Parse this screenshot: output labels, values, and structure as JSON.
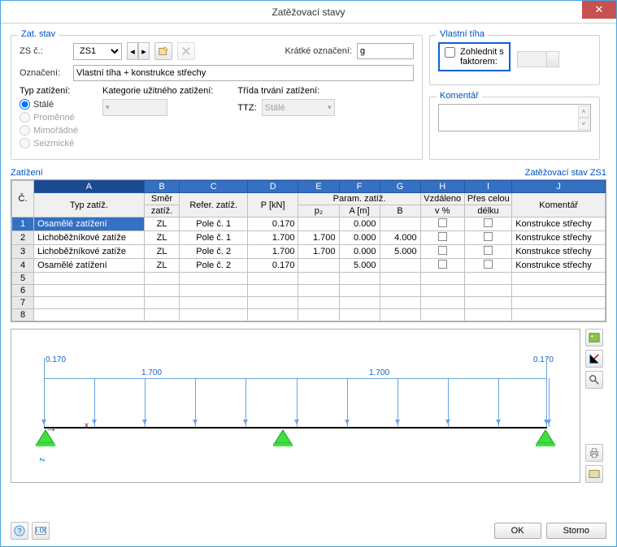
{
  "title": "Zatěžovací stavy",
  "zat_stav": {
    "legend": "Zat. stav",
    "zs_label": "ZS č.:",
    "zs_value": "ZS1",
    "kratke_label": "Krátké označení:",
    "kratke_value": "g",
    "oznaceni_label": "Označení:",
    "oznaceni_value": "Vlastní tíha + konstrukce střechy",
    "typ_label": "Typ zatížení:",
    "radios": [
      "Stálé",
      "Proměnné",
      "Mimořádné",
      "Seizmické"
    ],
    "kategorie_label": "Kategorie užitného zatížení:",
    "trida_label": "Třída trvání zatížení:",
    "ttz_label": "TTZ:",
    "ttz_value": "Stálé"
  },
  "vlastni_tiha": {
    "legend": "Vlastní tíha",
    "check_label1": "Zohlednit s",
    "check_label2": "faktorem:"
  },
  "komentar_legend": "Komentář",
  "zatizeni_label": "Zatížení",
  "zatizeni_right": "Zatěžovací stav ZS1",
  "columns": {
    "c": "Č.",
    "letters": [
      "A",
      "B",
      "C",
      "D",
      "E",
      "F",
      "G",
      "H",
      "I",
      "J"
    ],
    "h1": [
      "Typ zatíž.",
      "Směr zatíž.",
      "Refer. zatíž.",
      "P [kN]",
      "p₂",
      "A [m]",
      "B",
      "Vzdáleno v %",
      "Přes celou délku",
      "Komentář"
    ],
    "group_param": "Param. zatíž."
  },
  "rows": [
    {
      "n": "1",
      "typ": "Osamělé zatížení",
      "smer": "ZL",
      "ref": "Pole č. 1",
      "p": "0.170",
      "p2": "",
      "a": "0.000",
      "b": "",
      "vz": false,
      "pc": false,
      "kom": "Konstrukce střechy"
    },
    {
      "n": "2",
      "typ": "Lichoběžníkové zatíže",
      "smer": "ZL",
      "ref": "Pole č. 1",
      "p": "1.700",
      "p2": "1.700",
      "a": "0.000",
      "b": "4.000",
      "vz": false,
      "pc": false,
      "kom": "Konstrukce střechy"
    },
    {
      "n": "3",
      "typ": "Lichoběžníkové zatíže",
      "smer": "ZL",
      "ref": "Pole č. 2",
      "p": "1.700",
      "p2": "1.700",
      "a": "0.000",
      "b": "5.000",
      "vz": false,
      "pc": false,
      "kom": "Konstrukce střechy"
    },
    {
      "n": "4",
      "typ": "Osamělé zatížení",
      "smer": "ZL",
      "ref": "Pole č. 2",
      "p": "0.170",
      "p2": "",
      "a": "5.000",
      "b": "",
      "vz": false,
      "pc": false,
      "kom": "Konstrukce střechy"
    },
    {
      "n": "5"
    },
    {
      "n": "6"
    },
    {
      "n": "7"
    },
    {
      "n": "8"
    }
  ],
  "preview": {
    "v1": "0.170",
    "v2": "1.700",
    "v3": "1.700",
    "v4": "0.170",
    "ax": "x",
    "az": "z"
  },
  "buttons": {
    "ok": "OK",
    "storno": "Storno"
  }
}
